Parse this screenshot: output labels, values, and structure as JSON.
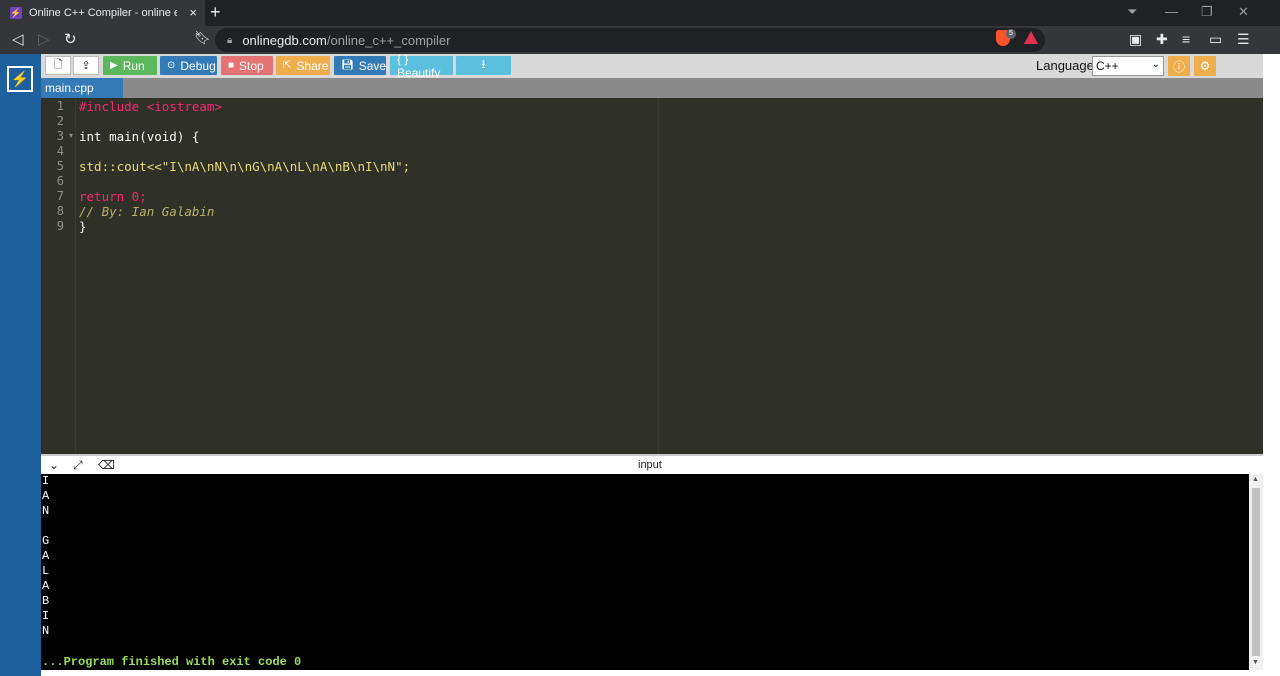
{
  "browser": {
    "tab_title": "Online C++ Compiler - online editor",
    "tab_close": "×",
    "new_tab": "+",
    "url_host": "onlinegdb.com",
    "url_path": "/online_c++_compiler",
    "brave_badge": "5"
  },
  "toolbar": {
    "run": "Run",
    "debug": "Debug",
    "stop": "Stop",
    "share": "Share",
    "save": "Save",
    "beautify": "{ } Beautify",
    "language_label": "Language",
    "language_value": "C++"
  },
  "colors": {
    "run": "#5cb85c",
    "debug": "#337ab7",
    "stop": "#e57373",
    "share": "#f0ad4e",
    "save": "#337ab7",
    "beautify": "#5bc0de",
    "download": "#5bc0de"
  },
  "file_tab": "main.cpp",
  "editor": {
    "line_numbers": [
      "1",
      "2",
      "3",
      "4",
      "5",
      "6",
      "7",
      "8",
      "9"
    ],
    "lines": [
      "#include <iostream>",
      "",
      "int main(void) {",
      "",
      "std::cout<<\"I\\nA\\nN\\n\\nG\\nA\\nL\\nA\\nB\\nI\\nN\";",
      "",
      "return 0;",
      "// By: Ian Galabin",
      "}"
    ]
  },
  "io": {
    "label": "input"
  },
  "console": {
    "output_lines": [
      "I",
      "A",
      "N",
      "",
      "G",
      "A",
      "L",
      "A",
      "B",
      "I",
      "N"
    ],
    "finish": "...Program finished with exit code 0"
  }
}
